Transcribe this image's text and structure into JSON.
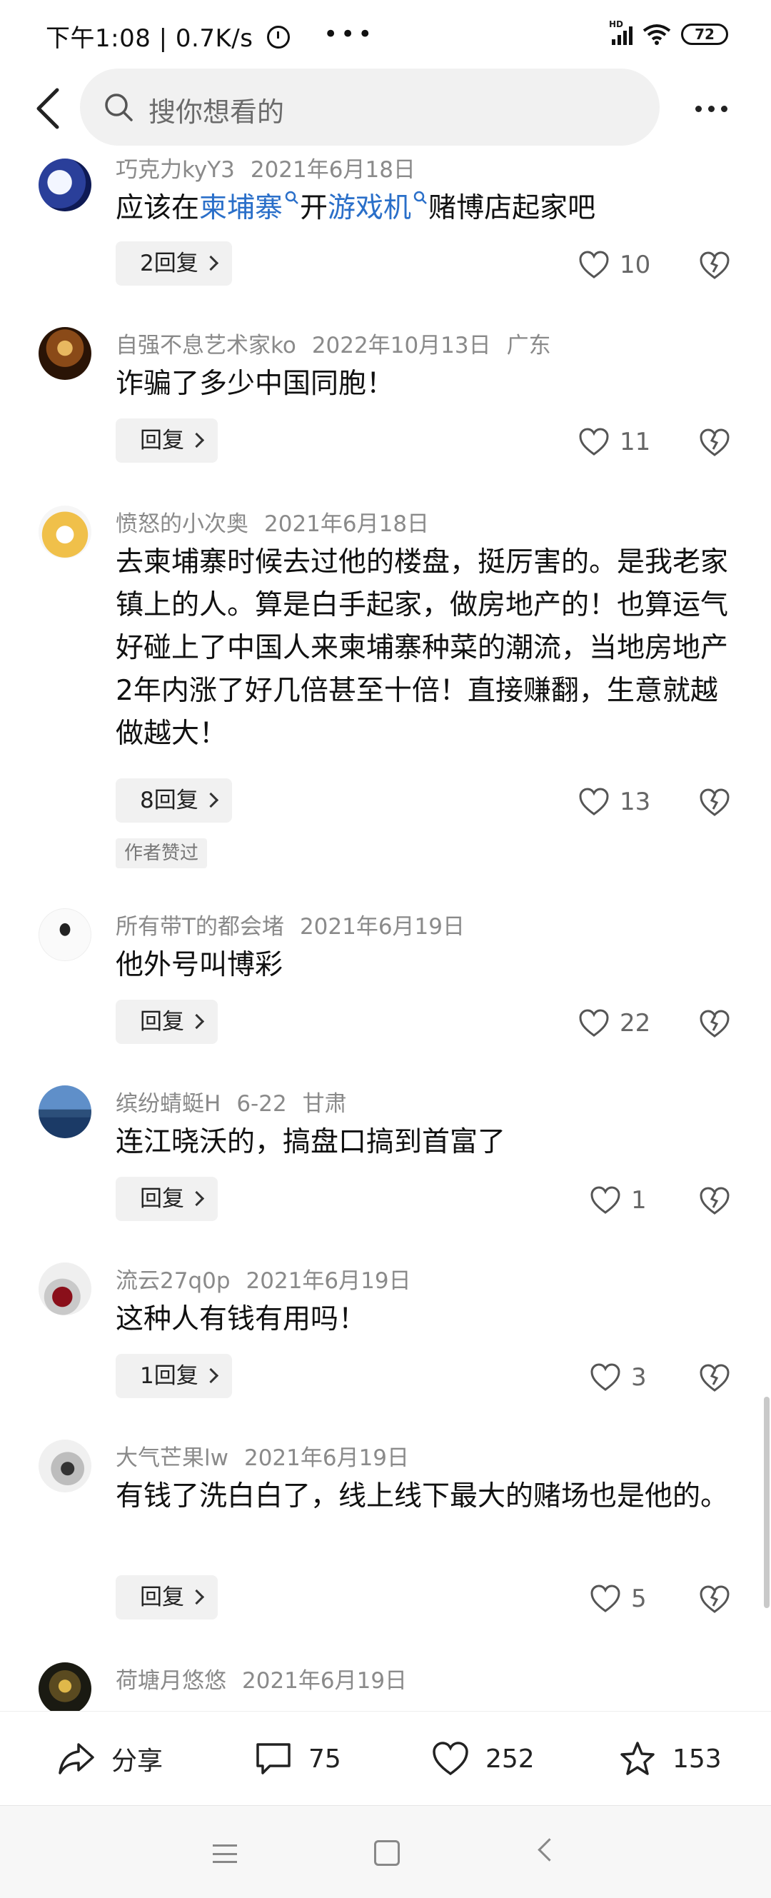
{
  "status_bar": {
    "time_network": "下午1:08 | 0.7K/s",
    "dots": "•••",
    "signal_label": "HD",
    "battery": "72"
  },
  "header": {
    "search_placeholder": "搜你想看的"
  },
  "colors": {
    "keyword": "#2a6fc9",
    "meta_text": "#8a8a8a",
    "reply_bg": "#f1f1f1"
  },
  "comments": [
    {
      "user": "巧克力kyY3",
      "date": "2021年6月18日",
      "location": "",
      "text_parts": [
        "应该在",
        "柬埔寨",
        "开",
        "游戏机",
        "赌博店起家吧"
      ],
      "reply_label": "2回复",
      "likes": "10",
      "badge": ""
    },
    {
      "user": "自强不息艺术家ko",
      "date": "2022年10月13日",
      "location": "广东",
      "text": "诈骗了多少中国同胞！",
      "reply_label": "回复",
      "likes": "11",
      "badge": ""
    },
    {
      "user": "愤怒的小次奥",
      "date": "2021年6月18日",
      "location": "",
      "text": "去柬埔寨时候去过他的楼盘，挺厉害的。是我老家镇上的人。算是白手起家，做房地产的！也算运气好碰上了中国人来柬埔寨种菜的潮流，当地房地产2年内涨了好几倍甚至十倍！直接赚翻，生意就越做越大！",
      "reply_label": "8回复",
      "likes": "13",
      "badge": "作者赞过"
    },
    {
      "user": "所有带T的都会堵",
      "date": "2021年6月19日",
      "location": "",
      "text": "他外号叫博彩",
      "reply_label": "回复",
      "likes": "22",
      "badge": ""
    },
    {
      "user": "缤纷蜻蜓H",
      "date": "6-22",
      "location": "甘肃",
      "text": "连江晓沃的，搞盘口搞到首富了",
      "reply_label": "回复",
      "likes": "1",
      "badge": ""
    },
    {
      "user": "流云27q0p",
      "date": "2021年6月19日",
      "location": "",
      "text": "这种人有钱有用吗！",
      "reply_label": "1回复",
      "likes": "3",
      "badge": ""
    },
    {
      "user": "大气芒果lw",
      "date": "2021年6月19日",
      "location": "",
      "text": "有钱了洗白白了，线上线下最大的赌场也是他的。",
      "reply_label": "回复",
      "likes": "5",
      "badge": ""
    },
    {
      "user": "荷塘月悠悠",
      "date": "2021年6月19日",
      "location": "",
      "text": "",
      "reply_label": "",
      "likes": "",
      "badge": ""
    }
  ],
  "action_bar": {
    "share_label": "分享",
    "comments_count": "75",
    "likes_count": "252",
    "favorites_count": "153"
  }
}
